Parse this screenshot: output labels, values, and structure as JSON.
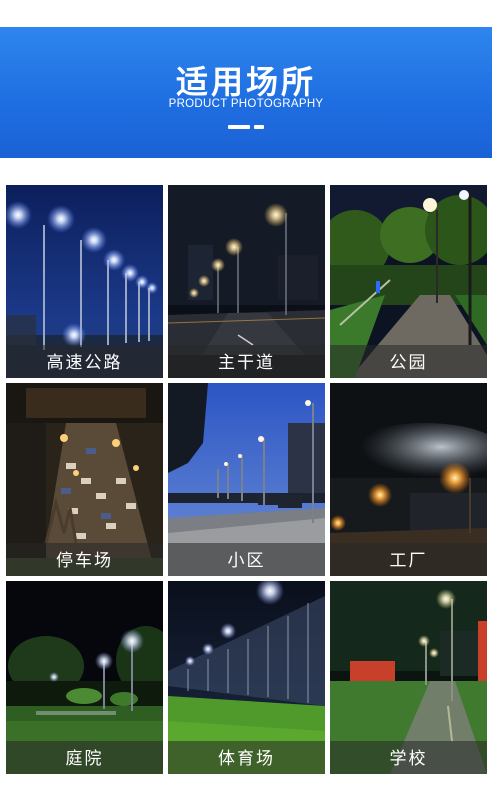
{
  "banner": {
    "title": "适用场所",
    "subtitle": "PRODUCT PHOTOGRAPHY"
  },
  "tiles": [
    {
      "label": "高速公路",
      "scene": "highway-night"
    },
    {
      "label": "主干道",
      "scene": "main-road-night"
    },
    {
      "label": "公园",
      "scene": "park-path-night"
    },
    {
      "label": "停车场",
      "scene": "parking-lot-aerial"
    },
    {
      "label": "小区",
      "scene": "residential-street-dusk"
    },
    {
      "label": "工厂",
      "scene": "factory-night"
    },
    {
      "label": "庭院",
      "scene": "courtyard-night"
    },
    {
      "label": "体育场",
      "scene": "sports-field-night"
    },
    {
      "label": "学校",
      "scene": "school-yard-rain"
    }
  ],
  "colors": {
    "banner": "#1f6fe2",
    "caption_overlay": "#282828"
  }
}
